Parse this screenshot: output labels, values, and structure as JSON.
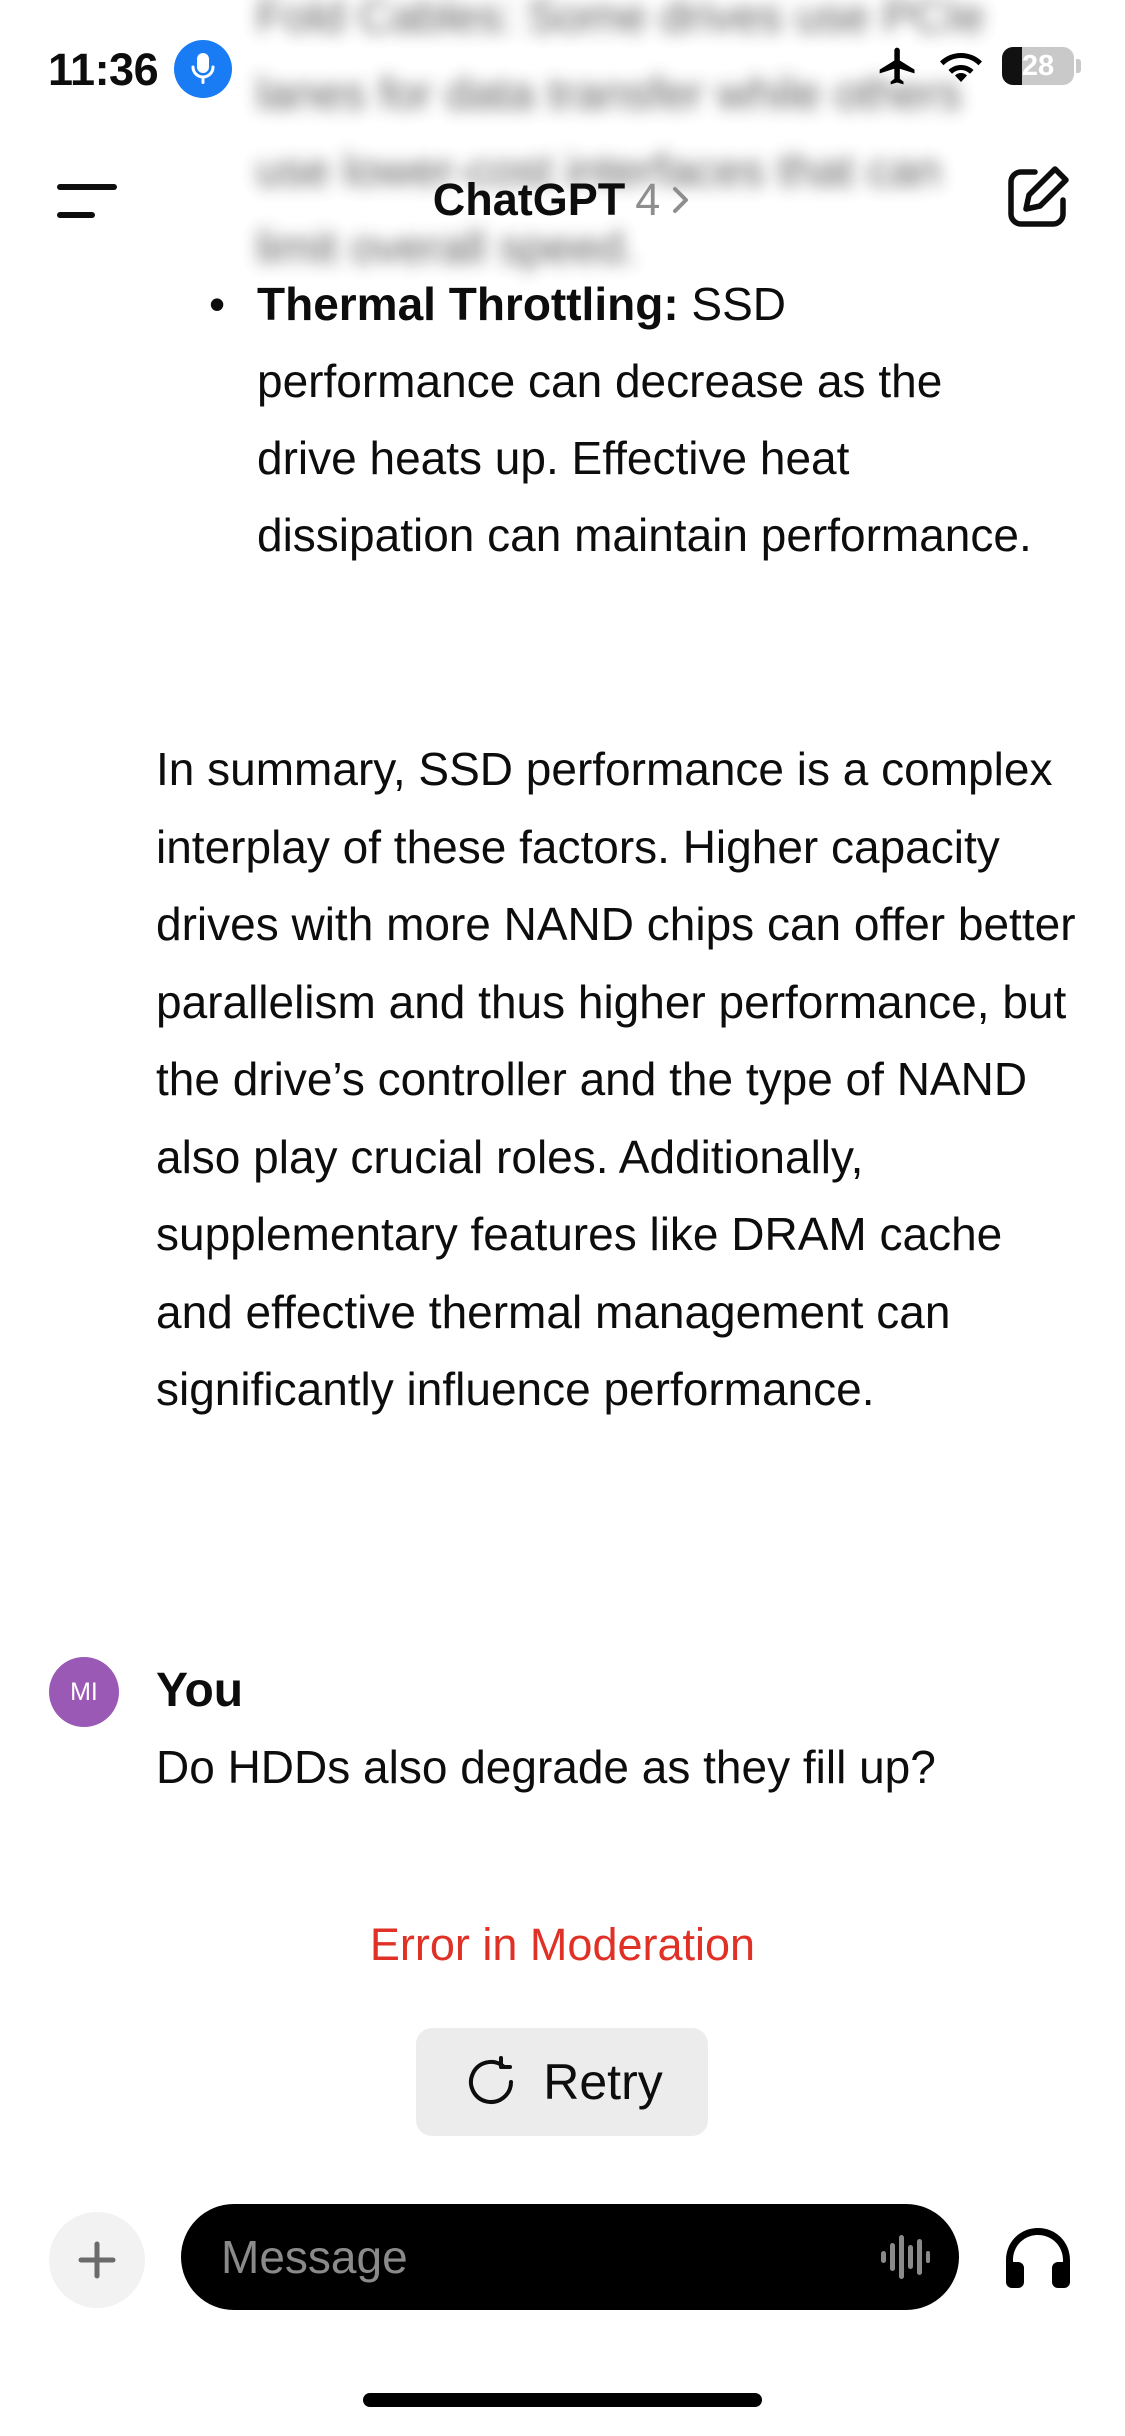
{
  "status_bar": {
    "time": "11:36",
    "battery_percent": "28",
    "battery_level": 0.28
  },
  "header": {
    "model_name": "ChatGPT",
    "model_version": "4"
  },
  "conversation": {
    "blurred_prev_item": "Fold Cables: Some drives use PCIe lanes for data transfer while others use lower-cost interfaces that can limit overall speed.",
    "thermal_item": {
      "title": "Thermal Throttling:",
      "text": " SSD performance can decrease as the drive heats up. Effective heat dissipation can maintain performance."
    },
    "summary": "In summary, SSD performance is a complex interplay of these factors. Higher capacity drives with more NAND chips can offer better parallelism and thus higher performance, but the drive’s controller and the type of NAND also play crucial roles. Additionally, supplementary features like DRAM cache and effective thermal management can significantly influence performance.",
    "user": {
      "avatar_initials": "MI",
      "avatar_color": "#9b59b6",
      "name": "You",
      "message": "Do HDDs also degrade as they fill up?"
    },
    "error_text": "Error in Moderation",
    "retry_label": "Retry"
  },
  "composer": {
    "placeholder": "Message"
  },
  "colors": {
    "error": "#e03127",
    "mic_accent": "#1a7cf5"
  },
  "icons": [
    "mic-icon",
    "airplane-icon",
    "wifi-icon",
    "battery-icon",
    "menu-icon",
    "chevron-right-icon",
    "compose-icon",
    "retry-icon",
    "plus-icon",
    "voice-waveform-icon",
    "headphones-icon"
  ]
}
